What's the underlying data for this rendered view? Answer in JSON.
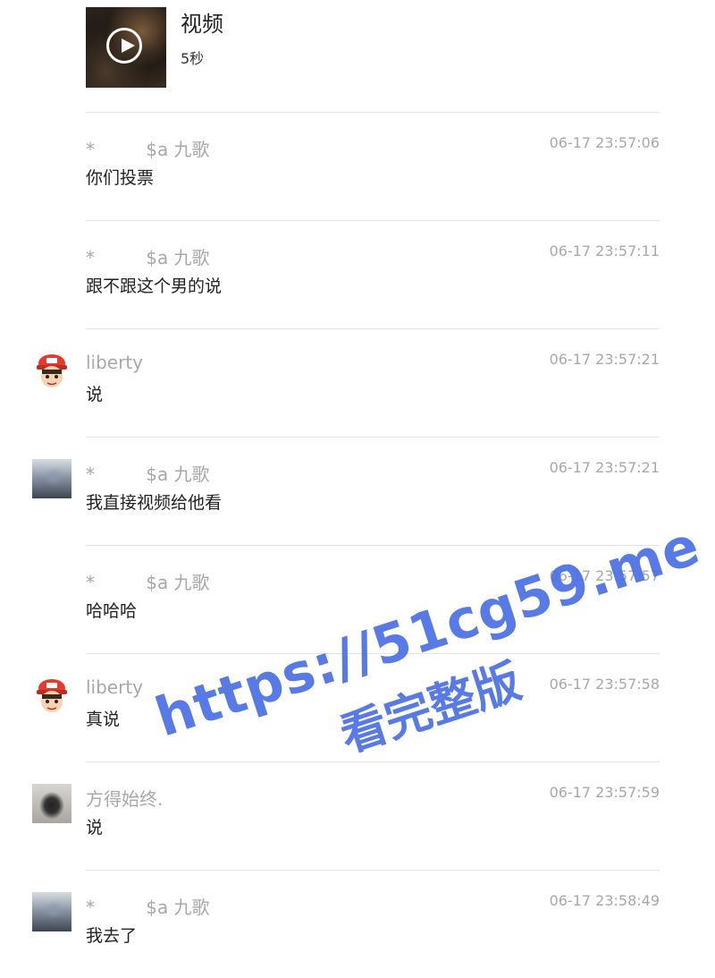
{
  "video": {
    "title": "视频",
    "duration": "5秒",
    "thumbnail_icon": "play-icon"
  },
  "messages": [
    {
      "sender": "*         $a 九歌",
      "time": "06-17 23:57:06",
      "text": "你们投票",
      "avatar": "none"
    },
    {
      "sender": "*         $a 九歌",
      "time": "06-17 23:57:11",
      "text": "跟不跟这个男的说",
      "avatar": "none"
    },
    {
      "sender": "liberty",
      "time": "06-17 23:57:21",
      "text": "说",
      "avatar": "cartoon-avatar"
    },
    {
      "sender": "*         $a 九歌",
      "time": "06-17 23:57:21",
      "text": "我直接视频给他看",
      "avatar": "photo-avatar"
    },
    {
      "sender": "*         $a 九歌",
      "time": "06-17 23:57:57",
      "text": "哈哈哈",
      "avatar": "none"
    },
    {
      "sender": "liberty",
      "time": "06-17 23:57:58",
      "text": "真说",
      "avatar": "cartoon-avatar"
    },
    {
      "sender": "方得始终.",
      "time": "06-17 23:57:59",
      "text": "说",
      "avatar": "photo-avatar"
    },
    {
      "sender": "*         $a 九歌",
      "time": "06-17 23:58:49",
      "text": "我去了",
      "avatar": "photo-avatar"
    }
  ],
  "watermark": {
    "line1": "https://51cg59.me",
    "line2": "看完整版",
    "color": "#4a6fe6"
  },
  "colors": {
    "meta_text": "#a8a8a8",
    "body_text": "#222222",
    "divider": "#e4e4e4"
  }
}
